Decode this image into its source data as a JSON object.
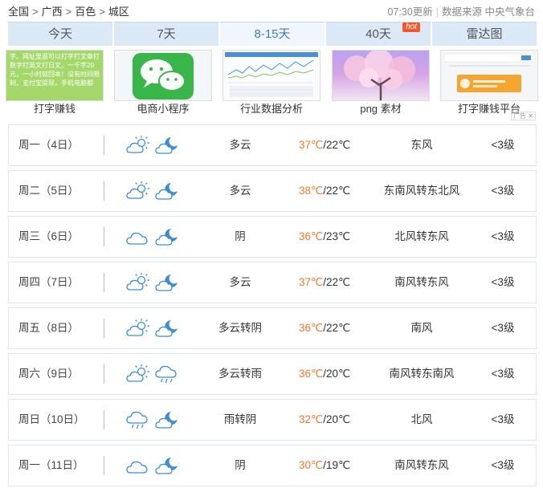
{
  "breadcrumb": {
    "items": [
      "全国",
      "广西",
      "百色",
      "城区"
    ],
    "sep": ">"
  },
  "meta": {
    "update": "07:30更新",
    "source": "数据来源 中央气象台"
  },
  "tabs": [
    {
      "label": "今天"
    },
    {
      "label": "7天"
    },
    {
      "label": "8-15天",
      "active": true
    },
    {
      "label": "40天",
      "badge": "hot"
    },
    {
      "label": "雷达图"
    }
  ],
  "ads": {
    "items": [
      {
        "caption": "打字赚钱",
        "image_text": "字。网址里面可以打字打文章打数字打英文打日文。一千字20元，一小时就回本！没有时间限制，支付宝提现，手机电脑都"
      },
      {
        "caption": "电商小程序"
      },
      {
        "caption": "行业数据分析"
      },
      {
        "caption": "png 素材"
      },
      {
        "caption": "打字赚钱平台"
      }
    ],
    "tag": "广告"
  },
  "forecast": [
    {
      "day": "周一（4日）",
      "icon1": "partly-cloudy-day-icon",
      "icon2": "cloudy-night-icon",
      "cond": "多云",
      "high": "37℃",
      "low": "/22℃",
      "wind": "东风",
      "level": "<3级"
    },
    {
      "day": "周二（5日）",
      "icon1": "partly-cloudy-day-icon",
      "icon2": "cloudy-night-icon",
      "cond": "多云",
      "high": "38℃",
      "low": "/22℃",
      "wind": "东南风转东北风",
      "level": "<3级"
    },
    {
      "day": "周三（6日）",
      "icon1": "overcast-icon",
      "icon2": "cloudy-night-icon",
      "cond": "阴",
      "high": "36℃",
      "low": "/23℃",
      "wind": "北风转东风",
      "level": "<3级"
    },
    {
      "day": "周四（7日）",
      "icon1": "partly-cloudy-day-icon",
      "icon2": "cloudy-night-icon",
      "cond": "多云",
      "high": "37℃",
      "low": "/22℃",
      "wind": "南风转东风",
      "level": "<3级"
    },
    {
      "day": "周五（8日）",
      "icon1": "partly-cloudy-day-icon",
      "icon2": "cloudy-night-icon",
      "cond": "多云转阴",
      "high": "36℃",
      "low": "/22℃",
      "wind": "南风",
      "level": "<3级"
    },
    {
      "day": "周六（9日）",
      "icon1": "partly-cloudy-day-icon",
      "icon2": "rain-icon",
      "cond": "多云转雨",
      "high": "36℃",
      "low": "/20℃",
      "wind": "南风转东南风",
      "level": "<3级"
    },
    {
      "day": "周日（10日）",
      "icon1": "rain-icon",
      "icon2": "cloudy-night-icon",
      "cond": "雨转阴",
      "high": "32℃",
      "low": "/20℃",
      "wind": "北风",
      "level": "<3级"
    },
    {
      "day": "周一（11日）",
      "icon1": "overcast-icon",
      "icon2": "cloudy-night-icon",
      "cond": "阴",
      "high": "30℃",
      "low": "/19℃",
      "wind": "南风转东风",
      "level": "<3级"
    }
  ]
}
